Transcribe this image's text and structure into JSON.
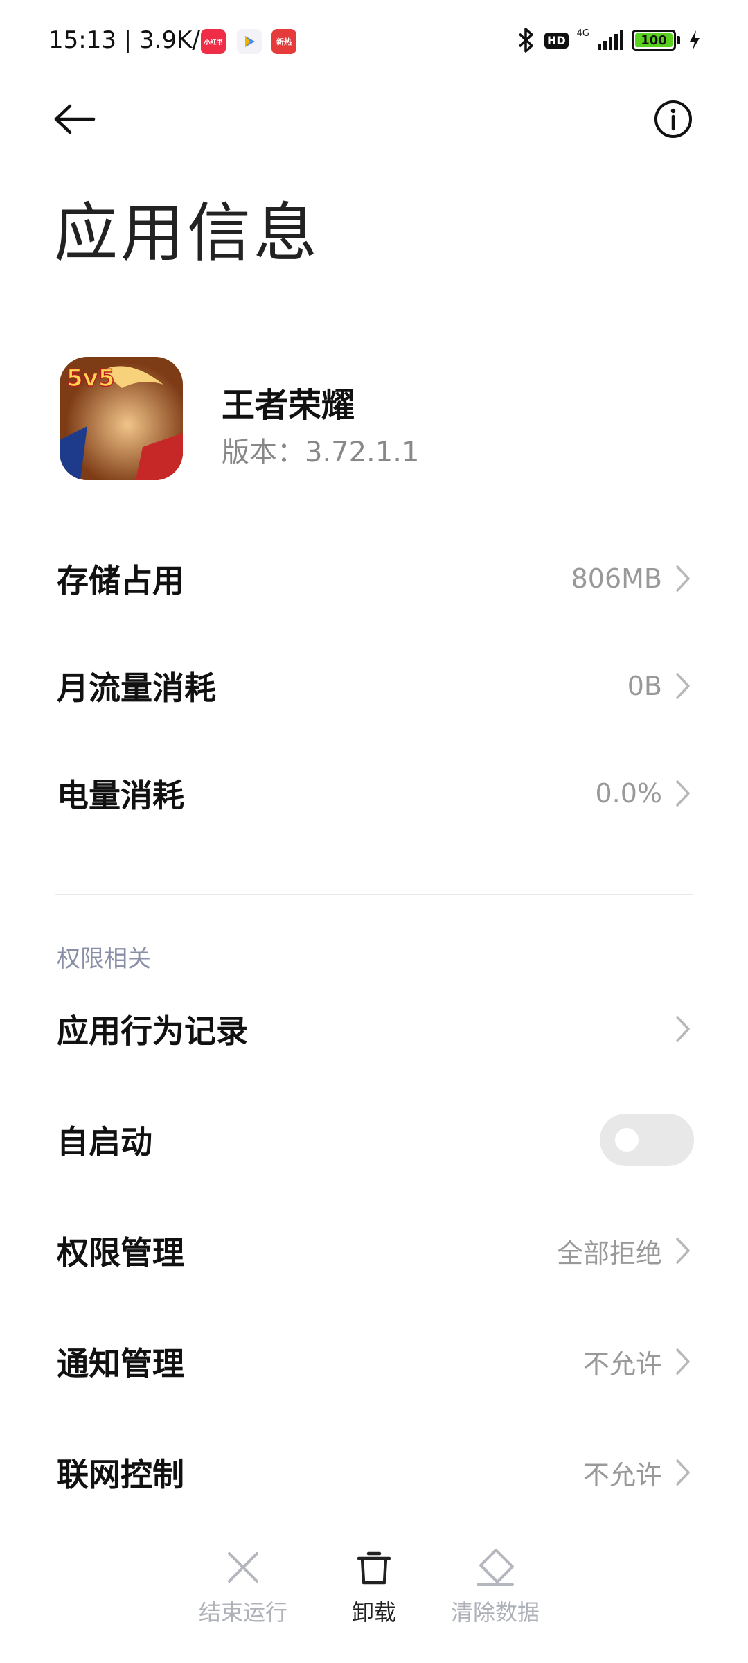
{
  "status_bar": {
    "time": "15:13 | 3.9K/s",
    "app_badges": [
      "小红书",
      "",
      "新热"
    ],
    "hd": "HD",
    "network": "4G",
    "battery": "100"
  },
  "header": {
    "title": "应用信息"
  },
  "app": {
    "name": "王者荣耀",
    "version": "版本：3.72.1.1",
    "icon_badge": "5v5"
  },
  "rows": [
    {
      "label": "存储占用",
      "value": "806MB"
    },
    {
      "label": "月流量消耗",
      "value": "0B"
    },
    {
      "label": "电量消耗",
      "value": "0.0%"
    }
  ],
  "permissions_section": {
    "title": "权限相关",
    "items": [
      {
        "label": "应用行为记录",
        "value": ""
      },
      {
        "label": "自启动",
        "toggle": false
      },
      {
        "label": "权限管理",
        "value": "全部拒绝"
      },
      {
        "label": "通知管理",
        "value": "不允许"
      },
      {
        "label": "联网控制",
        "value": "不允许"
      }
    ]
  },
  "bottom_actions": [
    {
      "label": "结束运行",
      "icon": "close-icon",
      "enabled": false
    },
    {
      "label": "卸载",
      "icon": "trash-icon",
      "enabled": true
    },
    {
      "label": "清除数据",
      "icon": "eraser-icon",
      "enabled": false
    }
  ],
  "colors": {
    "accent_section": "#8a8fa8",
    "muted": "#999999",
    "battery": "#5ad11e"
  }
}
